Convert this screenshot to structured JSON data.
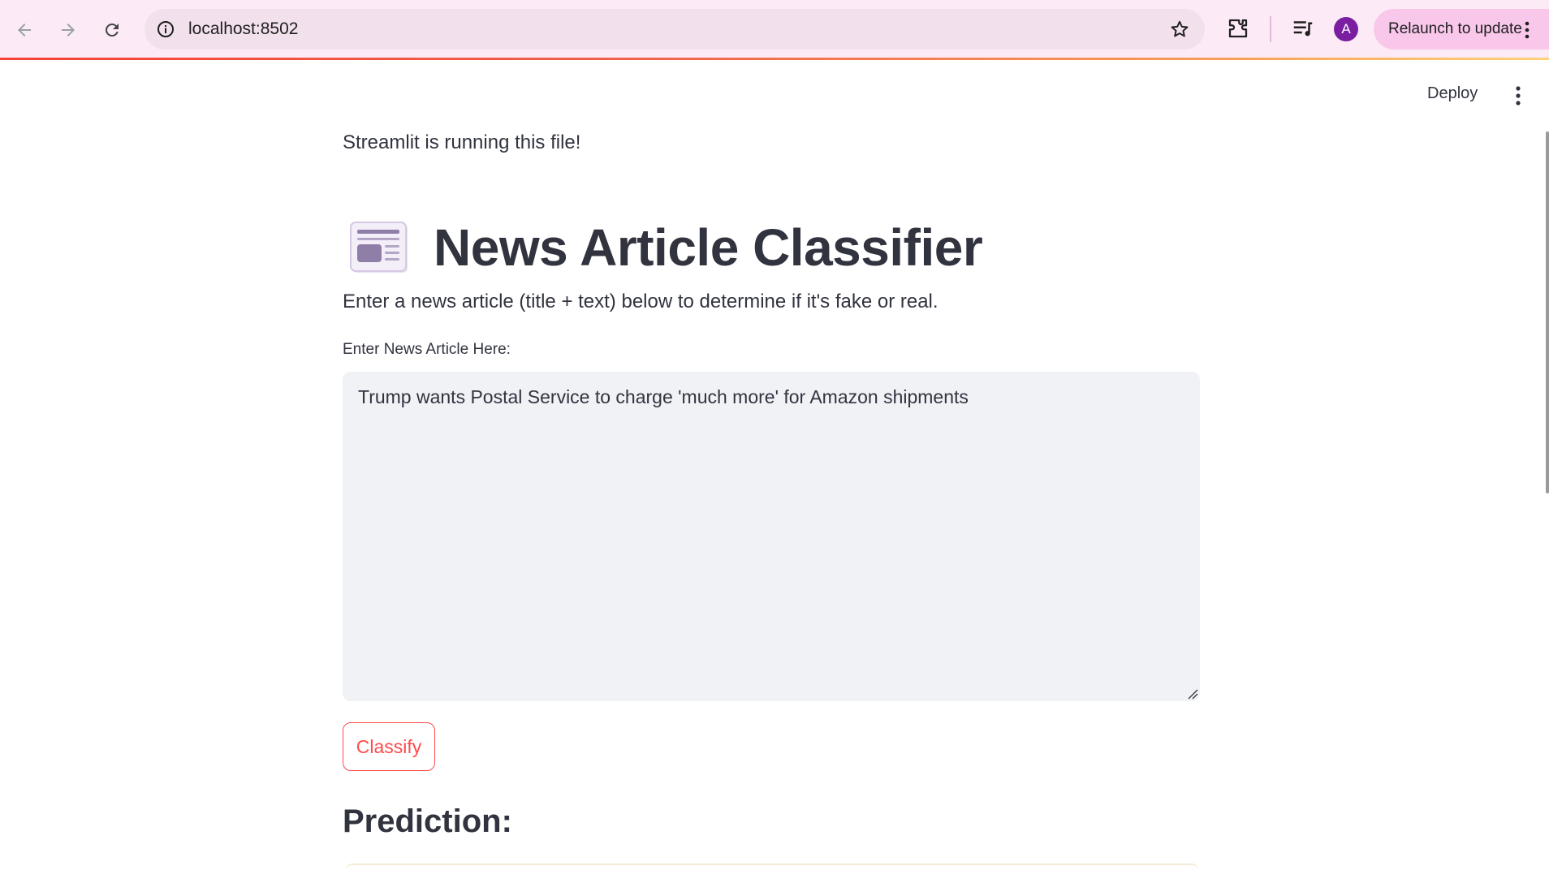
{
  "browser": {
    "url": "localhost:8502",
    "avatar_letter": "A",
    "relaunch_label": "Relaunch to update"
  },
  "app_header": {
    "deploy_label": "Deploy"
  },
  "main": {
    "running_text": "Streamlit is running this file!",
    "title": "News Article Classifier",
    "title_icon": "newspaper-icon",
    "description": "Enter a news article (title + text) below to determine if it's fake or real.",
    "input_label": "Enter News Article Here:",
    "input_value": "Trump wants Postal Service to charge 'much more' for Amazon shipments",
    "classify_label": "Classify",
    "prediction_heading": "Prediction:"
  },
  "colors": {
    "primary": "#ff4b4b",
    "text": "#31333f",
    "input_bg": "#f0f2f6",
    "chrome_bg": "#fcebf6",
    "avatar_bg": "#7b1fa2"
  }
}
